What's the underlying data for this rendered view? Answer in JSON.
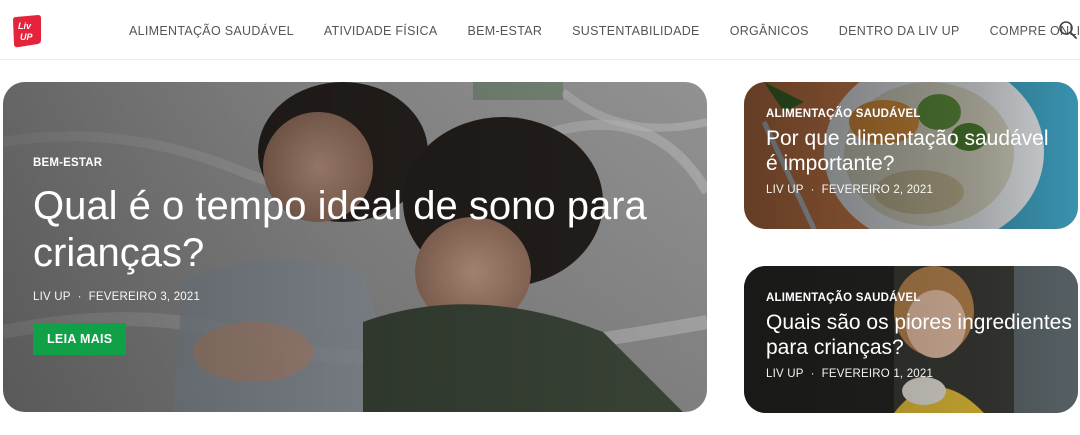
{
  "brand": {
    "logo_text": "Liv Up",
    "color": "#e5233b"
  },
  "nav": {
    "items": [
      "ALIMENTAÇÃO SAUDÁVEL",
      "ATIVIDADE FÍSICA",
      "BEM-ESTAR",
      "SUSTENTABILIDADE",
      "ORGÂNICOS",
      "DENTRO DA LIV UP",
      "COMPRE ONLINE"
    ],
    "search_icon": "search-icon"
  },
  "featured": {
    "category": "BEM-ESTAR",
    "title": "Qual é o tempo ideal de sono para crianças?",
    "author": "LIV UP",
    "date": "FEVEREIRO 3, 2021",
    "cta": "LEIA MAIS",
    "cta_color": "#0fa048"
  },
  "side_posts": [
    {
      "category": "ALIMENTAÇÃO SAUDÁVEL",
      "title": "Por que alimentação saudável é importante?",
      "author": "LIV UP",
      "date": "FEVEREIRO 2, 2021"
    },
    {
      "category": "ALIMENTAÇÃO SAUDÁVEL",
      "title": "Quais são os piores ingredientes para crianças?",
      "author": "LIV UP",
      "date": "FEVEREIRO 1, 2021"
    }
  ],
  "meta_separator": "·"
}
